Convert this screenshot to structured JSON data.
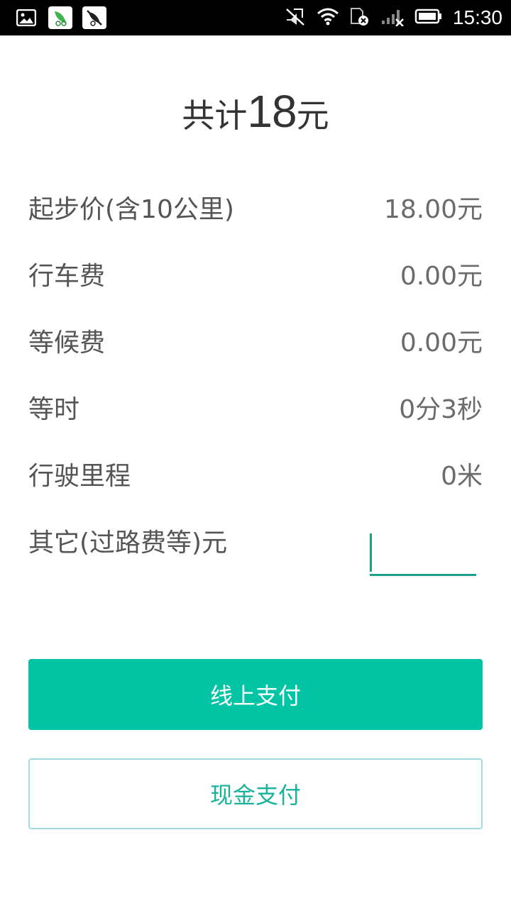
{
  "status_bar": {
    "time": "15:30",
    "left_icons": [
      "gallery-icon",
      "leaf-app-icon",
      "mute-app-icon"
    ],
    "right_icons": [
      "mute-icon",
      "wifi-icon",
      "sim-icon",
      "signal-icon",
      "battery-icon"
    ]
  },
  "total": {
    "prefix": "共计",
    "amount": "18",
    "unit": "元"
  },
  "fees": [
    {
      "label": "起步价(含10公里)",
      "value": "18.00元"
    },
    {
      "label": "行车费",
      "value": "0.00元"
    },
    {
      "label": "等候费",
      "value": "0.00元"
    },
    {
      "label": "等时",
      "value": "0分3秒"
    },
    {
      "label": "行驶里程",
      "value": "0米"
    }
  ],
  "other": {
    "label": "其它(过路费等)元",
    "value": ""
  },
  "buttons": {
    "online_pay": "线上支付",
    "cash_pay": "现金支付"
  },
  "colors": {
    "primary": "#00c4a4",
    "accent": "#1aa187",
    "cash_border": "#9fdbe4"
  }
}
